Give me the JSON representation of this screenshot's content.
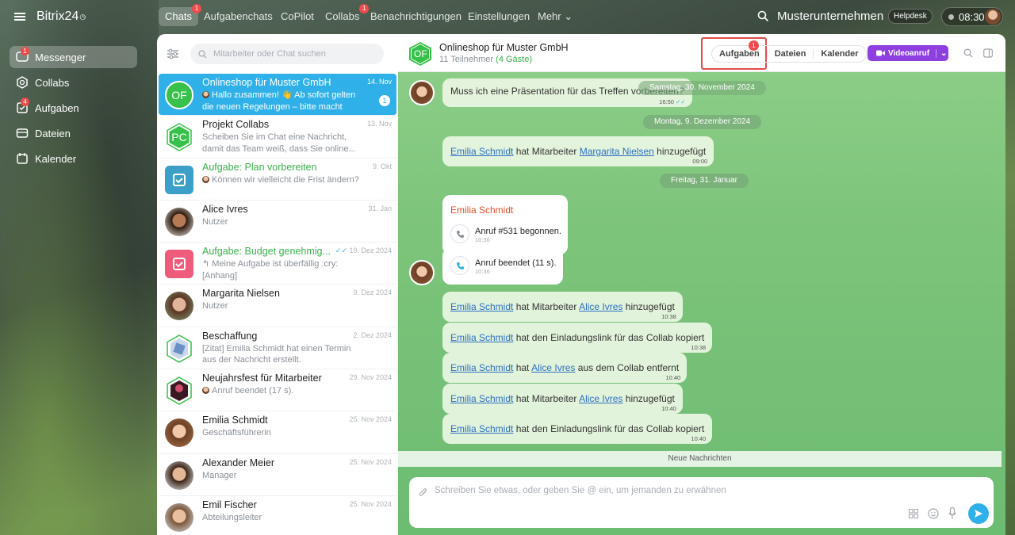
{
  "app": {
    "name": "Bitrix24",
    "clock_mark": "◷"
  },
  "nav": [
    {
      "label": "Messenger",
      "icon": "chat-icon",
      "badge": "1",
      "active": true
    },
    {
      "label": "Collabs",
      "icon": "collabs-icon",
      "badge": ""
    },
    {
      "label": "Aufgaben",
      "icon": "tasks-icon",
      "badge": "4"
    },
    {
      "label": "Dateien",
      "icon": "files-icon",
      "badge": ""
    },
    {
      "label": "Kalender",
      "icon": "calendar-icon",
      "badge": ""
    }
  ],
  "top": {
    "tabs": [
      {
        "label": "Chats",
        "badge": "1"
      },
      {
        "label": "Aufgabenchats",
        "badge": ""
      },
      {
        "label": "CoPilot",
        "badge": ""
      },
      {
        "label": "Collabs",
        "badge": "1"
      },
      {
        "label": "Benachrichtigungen",
        "badge": ""
      },
      {
        "label": "Einstellungen",
        "badge": ""
      },
      {
        "label": "Mehr ⌄",
        "badge": ""
      }
    ],
    "company": "Musterunternehmen",
    "helpdesk": "Helpdesk",
    "time": "08:30"
  },
  "list": {
    "search_placeholder": "Mitarbeiter oder Chat suchen",
    "items": [
      {
        "name": "Onlineshop für Muster GmbH",
        "date": "14. Nov",
        "preview": "Hallo zusammen! 👋 Ab sofort gelten die neuen Regelungen – bitte macht eu...",
        "counter": "1",
        "avatar": "OF"
      },
      {
        "name": "Projekt Collabs",
        "date": "13. Nov",
        "preview": "Scheiben Sie im Chat eine Nachricht, damit das Team weiß, dass Sie online...",
        "avatar": "PC"
      },
      {
        "name": "Aufgabe: Plan vorbereiten",
        "date": "9. Okt",
        "preview": "Können wir vielleicht die Frist ändern?"
      },
      {
        "name": "Alice Ivres",
        "date": "31. Jan",
        "preview": "Nutzer"
      },
      {
        "name": "Aufgabe: Budget genehmig...",
        "date": "19. Dez 2024",
        "preview": "↰ Meine Aufgabe ist überfällig :cry: [Anhang]"
      },
      {
        "name": "Margarita Nielsen",
        "date": "9. Dez 2024",
        "preview": "Nutzer"
      },
      {
        "name": "Beschaffung",
        "date": "2. Dez 2024",
        "preview": "[Zitat] Emilia Schmidt hat einen Termin aus der Nachricht erstellt."
      },
      {
        "name": "Neujahrsfest für Mitarbeiter",
        "date": "29. Nov 2024",
        "preview": "Anruf beendet (17 s)."
      },
      {
        "name": "Emilia Schmidt",
        "date": "25. Nov 2024",
        "preview": "Geschäftsführerin"
      },
      {
        "name": "Alexander Meier",
        "date": "25. Nov 2024",
        "preview": "Manager"
      },
      {
        "name": "Emil Fischer",
        "date": "25. Nov 2024",
        "preview": "Abteilungsleiter"
      }
    ]
  },
  "chat": {
    "title": "Onlineshop für Muster GmbH",
    "avatar": "OF",
    "participants": "11 Teilnehmer",
    "guests": "(4 Gäste)",
    "seg": [
      "Aufgaben",
      "Dateien",
      "Kalender"
    ],
    "seg_badge": "1",
    "video": "Videoanruf",
    "dates": [
      "Samstag, 30. November 2024",
      "Montag, 9. Dezember 2024",
      "Freitag, 31. Januar"
    ],
    "m0": {
      "text": "Muss ich eine Präsentation für das Treffen vorbereiten?",
      "time": "16:50"
    },
    "m1": {
      "a": "Emilia Schmidt",
      "b": "hat Mitarbeiter",
      "c": "Margarita Nielsen",
      "d": "hinzugefügt",
      "time": "09:00"
    },
    "call1": {
      "sender": "Emilia Schmidt",
      "text": "Anruf #531 begonnen.",
      "time": "10:36"
    },
    "call2": {
      "text": "Anruf beendet (11 s).",
      "time": "10:36"
    },
    "m2": {
      "a": "Emilia Schmidt",
      "b": "hat Mitarbeiter",
      "c": "Alice Ivres",
      "d": "hinzugefügt",
      "time": "10:38"
    },
    "m3": {
      "a": "Emilia Schmidt",
      "b": "hat den Einladungslink für das Collab kopiert",
      "time": "10:38"
    },
    "m4": {
      "a": "Emilia Schmidt",
      "b": "hat",
      "c": "Alice Ivres",
      "d": "aus dem Collab entfernt",
      "time": "10:40"
    },
    "m5": {
      "a": "Emilia Schmidt",
      "b": "hat Mitarbeiter",
      "c": "Alice Ivres",
      "d": "hinzugefügt",
      "time": "10:40"
    },
    "m6": {
      "a": "Emilia Schmidt",
      "b": "hat den Einladungslink für das Collab kopiert",
      "time": "10:40"
    },
    "new_messages": "Neue Nachrichten",
    "composer_placeholder": "Schreiben Sie etwas, oder geben Sie @ ein, um jemanden zu erwähnen"
  }
}
